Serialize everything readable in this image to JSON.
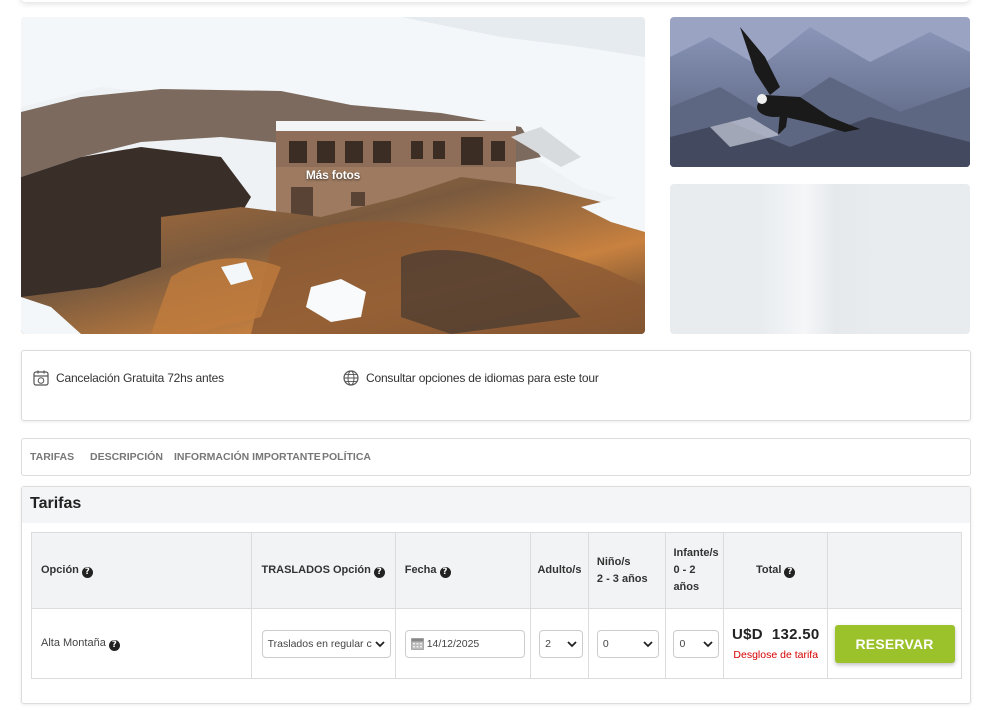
{
  "gallery": {
    "more_photos_label": "Más fotos"
  },
  "features": {
    "cancellation": "Cancelación Gratuita 72hs antes",
    "languages": "Consultar opciones de idiomas para este tour"
  },
  "tabs": [
    "TARIFAS",
    "DESCRIPCIÓN",
    "INFORMACIÓN IMPORTANTE",
    "POLÍTICA"
  ],
  "tarifas": {
    "title": "Tarifas",
    "headers": {
      "option": "Opción",
      "transfers": "TRASLADOS Opción",
      "date": "Fecha",
      "adults": "Adulto/s",
      "children_line1": "Niño/s",
      "children_line2": "2 - 3 años",
      "infants_line1": "Infante/s",
      "infants_line2": "0 - 2",
      "infants_line3": "años",
      "total": "Total"
    },
    "row": {
      "option": "Alta Montaña",
      "transfer_selected": "Traslados en regular c",
      "date": "14/12/2025",
      "adults": "2",
      "children": "0",
      "infants": "0",
      "total": "U$D  132.50",
      "breakdown_link": "Desglose de tarifa",
      "reserve_button": "RESERVAR"
    }
  },
  "colors": {
    "reserve_button": "#9bc22a",
    "breakdown_link": "#d40000",
    "header_bg": "#f2f3f4"
  }
}
